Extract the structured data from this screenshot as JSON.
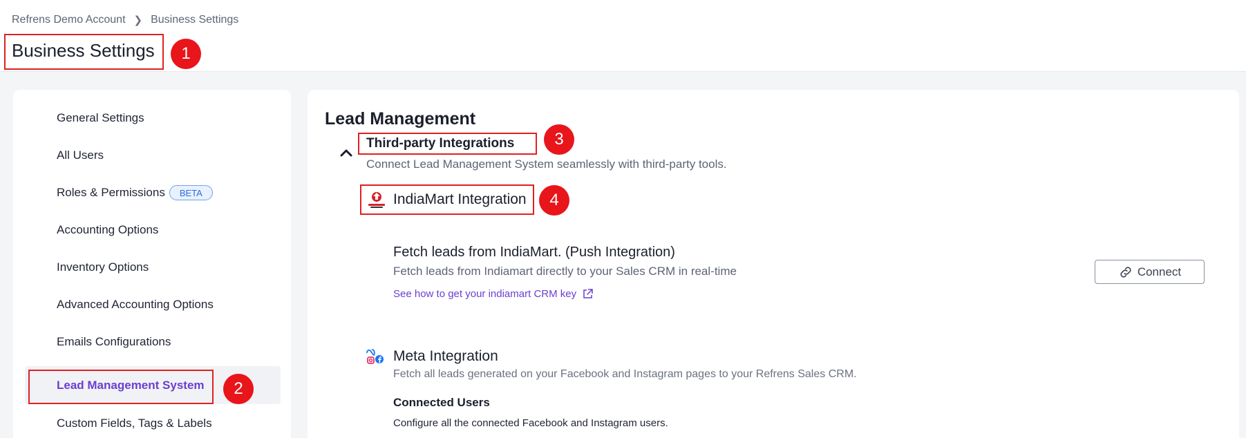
{
  "breadcrumb": {
    "items": [
      "Refrens Demo Account",
      "Business Settings"
    ]
  },
  "page": {
    "title": "Business Settings"
  },
  "sidebar": {
    "items": [
      {
        "label": "General Settings"
      },
      {
        "label": "All Users"
      },
      {
        "label": "Roles & Permissions",
        "badge": "BETA"
      },
      {
        "label": "Accounting Options"
      },
      {
        "label": "Inventory Options"
      },
      {
        "label": "Advanced Accounting Options"
      },
      {
        "label": "Emails Configurations"
      },
      {
        "label": "Lead Management System",
        "active": true
      },
      {
        "label": "Custom Fields, Tags & Labels"
      }
    ]
  },
  "main": {
    "section_title": "Lead Management",
    "third_party": {
      "title": "Third-party Integrations",
      "description": "Connect Lead Management System seamlessly with third-party tools.",
      "expanded": true
    },
    "indiamart": {
      "title": "IndiaMart Integration",
      "logo_icon": "indiamart-logo",
      "fetch_title": "Fetch leads from IndiaMart. (Push Integration)",
      "fetch_description": "Fetch leads from Indiamart directly to your Sales CRM in real-time",
      "link_text": "See how to get your indiamart CRM key",
      "connect_label": "Connect"
    },
    "meta": {
      "title": "Meta Integration",
      "logo_icon": "meta-logo",
      "description": "Fetch all leads generated on your Facebook and Instagram pages to your Refrens Sales CRM.",
      "connected_users_title": "Connected Users",
      "connected_users_description": "Configure all the connected Facebook and Instagram users."
    }
  },
  "annotations": [
    "1",
    "2",
    "3",
    "4"
  ],
  "colors": {
    "accent": "#6a3fd0",
    "annotation": "#e8151b",
    "beta": "#2a6fd6"
  }
}
